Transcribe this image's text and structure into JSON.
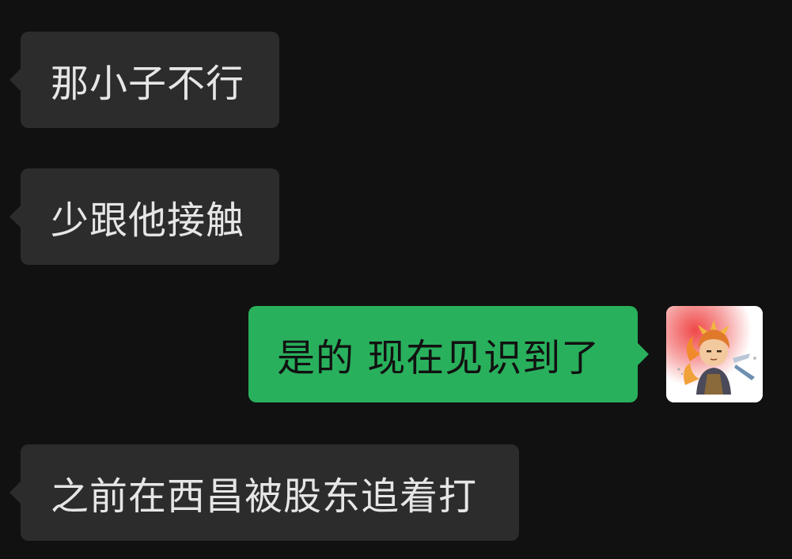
{
  "messages": [
    {
      "side": "left",
      "text": "那小子不行"
    },
    {
      "side": "left",
      "text": "少跟他接触"
    },
    {
      "side": "right",
      "text": "是的 现在见识到了"
    },
    {
      "side": "left",
      "text": "之前在西昌被股东追着打"
    }
  ],
  "avatar": {
    "icon": "cartoon-warrior-avatar-icon"
  },
  "colors": {
    "background": "#111111",
    "incoming_bubble": "#2c2c2c",
    "outgoing_bubble": "#29b05c",
    "incoming_text": "#e6e6e6",
    "outgoing_text": "#111111"
  }
}
